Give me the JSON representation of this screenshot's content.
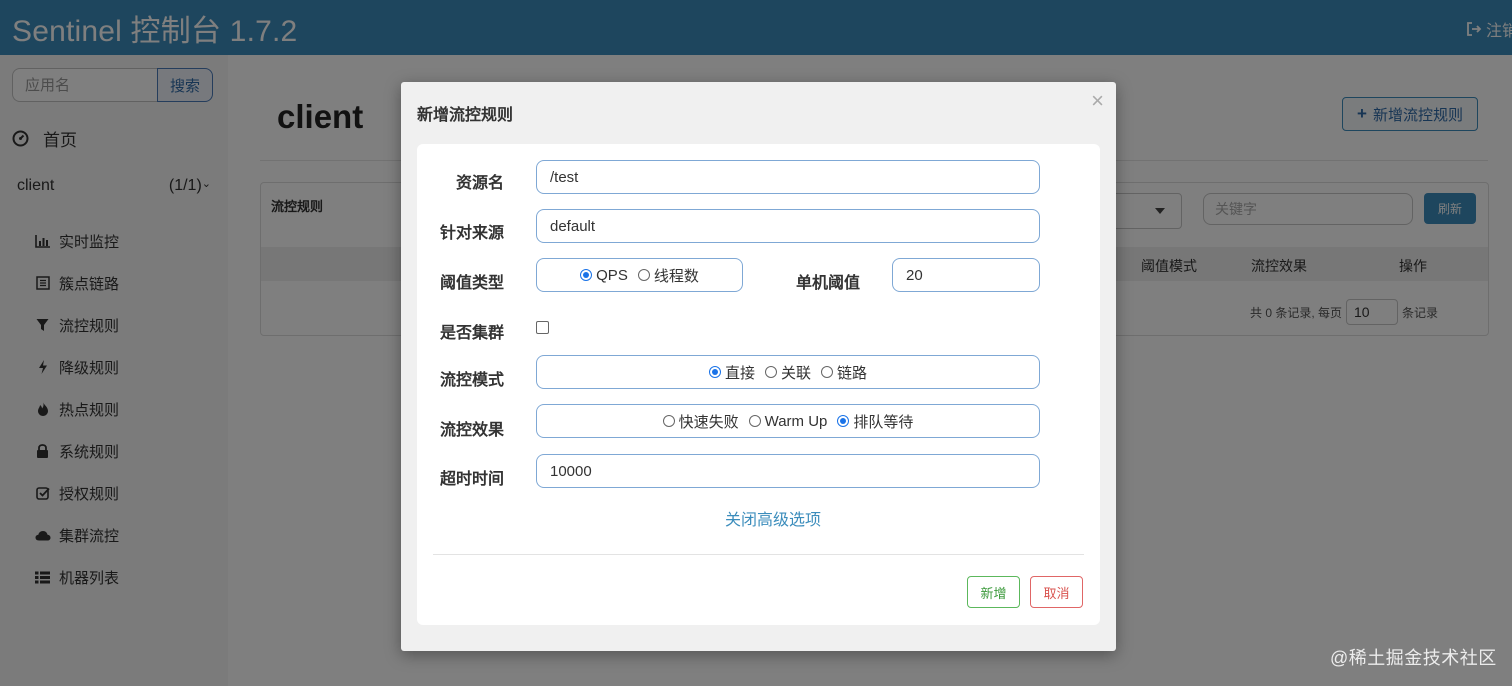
{
  "header": {
    "title": "Sentinel 控制台 1.7.2",
    "logout_label": "注销"
  },
  "sidebar": {
    "search_placeholder": "应用名",
    "search_button": "搜索",
    "home_label": "首页",
    "app_name": "client",
    "app_count": "(1/1)",
    "items": [
      {
        "label": "实时监控",
        "icon": "bar-chart-icon"
      },
      {
        "label": "簇点链路",
        "icon": "list-alt-icon"
      },
      {
        "label": "流控规则",
        "icon": "filter-icon"
      },
      {
        "label": "降级规则",
        "icon": "flash-icon"
      },
      {
        "label": "热点规则",
        "icon": "fire-icon"
      },
      {
        "label": "系统规则",
        "icon": "lock-icon"
      },
      {
        "label": "授权规则",
        "icon": "check-icon"
      },
      {
        "label": "集群流控",
        "icon": "cloud-icon"
      },
      {
        "label": "机器列表",
        "icon": "th-list-icon"
      }
    ]
  },
  "main": {
    "title": "client",
    "add_rule_button": "新增流控规则",
    "panel_title": "流控规则",
    "keyword_placeholder": "关键字",
    "refresh_button": "刷新",
    "columns": [
      "阈值模式",
      "流控效果",
      "操作"
    ],
    "pager": {
      "total_text": "共 0 条记录, 每页",
      "page_size": "10",
      "suffix": "条记录"
    }
  },
  "modal": {
    "title": "新增流控规则",
    "close": "×",
    "fields": {
      "resource": {
        "label": "资源名",
        "value": "/test"
      },
      "origin": {
        "label": "针对来源",
        "value": "default"
      },
      "threshold_type": {
        "label": "阈值类型",
        "options": [
          "QPS",
          "线程数"
        ],
        "selected": "QPS"
      },
      "threshold": {
        "label": "单机阈值",
        "value": "20"
      },
      "cluster": {
        "label": "是否集群",
        "checked": false
      },
      "mode": {
        "label": "流控模式",
        "options": [
          "直接",
          "关联",
          "链路"
        ],
        "selected": "直接"
      },
      "effect": {
        "label": "流控效果",
        "options": [
          "快速失败",
          "Warm Up",
          "排队等待"
        ],
        "selected": "排队等待"
      },
      "timeout": {
        "label": "超时时间",
        "value": "10000"
      }
    },
    "advanced_link": "关闭高级选项",
    "add_button": "新增",
    "cancel_button": "取消"
  },
  "watermark": "@稀土掘金技术社区",
  "colors": {
    "header": "#3c8dbc",
    "accent": "#3c8dbc",
    "success": "#5cb85c",
    "danger": "#d9534f"
  }
}
